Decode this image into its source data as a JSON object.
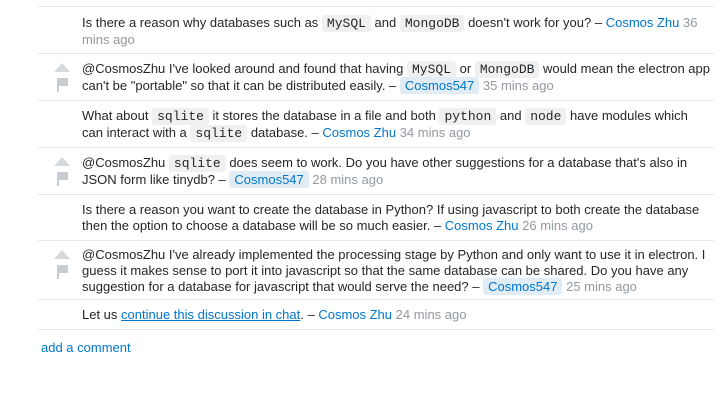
{
  "comments": [
    {
      "parts": [
        "Is there a reason why databases such as ",
        "MySQL",
        " and ",
        "MongoDB",
        " doesn't work for you? – "
      ],
      "user": "Cosmos Zhu",
      "time": "36 mins ago"
    },
    {
      "parts": [
        "@CosmosZhu I've looked around and found that having ",
        "MySQL",
        " or ",
        "MongoDB",
        " would mean the electron app can't be \"portable\" so that it can be distributed easily. – "
      ],
      "user": "Cosmos547",
      "time": "35 mins ago"
    },
    {
      "parts": [
        "What about ",
        "sqlite",
        " it stores the database in a file and both ",
        "python",
        " and ",
        "node",
        " have modules which can interact with a ",
        "sqlite",
        " database. – "
      ],
      "user": "Cosmos Zhu",
      "time": "34 mins ago"
    },
    {
      "parts": [
        "@CosmosZhu ",
        "sqlite",
        " does seem to work. Do you have other suggestions for a database that's also in JSON form like tinydb? – "
      ],
      "user": "Cosmos547",
      "time": "28 mins ago"
    },
    {
      "parts": [
        "Is there a reason you want to create the database in Python? If using javascript to both create the database then the option to choose a database will be so much easier. – "
      ],
      "user": "Cosmos Zhu",
      "time": "26 mins ago"
    },
    {
      "parts": [
        "@CosmosZhu I've already implemented the processing stage by Python and only want to use it in electron. I guess it makes sense to port it into javascript so that the same database can be shared. Do you have any suggestion for a database for javascript that would serve the need? – "
      ],
      "user": "Cosmos547",
      "time": "25 mins ago"
    },
    {
      "parts": [
        "Let us ",
        "continue this discussion in chat",
        ". – "
      ],
      "user": "Cosmos Zhu",
      "time": "24 mins ago"
    }
  ],
  "add_comment": "add a comment"
}
